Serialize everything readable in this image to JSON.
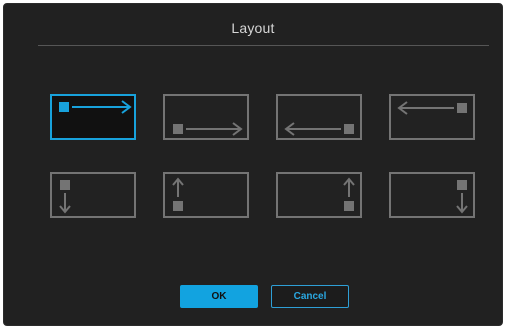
{
  "dialog": {
    "title": "Layout",
    "selected_index": 0,
    "options": [
      {
        "id": "left-to-right-marker-left",
        "icon": "square-arrow-right-icon"
      },
      {
        "id": "left-to-right-marker-bottom",
        "icon": "square-arrow-right-low-icon"
      },
      {
        "id": "right-to-left-marker-right",
        "icon": "arrow-left-square-low-icon"
      },
      {
        "id": "right-to-left-marker-top",
        "icon": "arrow-left-square-icon"
      },
      {
        "id": "top-to-bottom-left",
        "icon": "square-arrow-down-icon"
      },
      {
        "id": "bottom-to-top-left",
        "icon": "arrow-up-square-icon"
      },
      {
        "id": "bottom-to-top-right",
        "icon": "arrow-up-square-right-icon"
      },
      {
        "id": "top-to-bottom-right",
        "icon": "square-arrow-down-right-icon"
      }
    ],
    "ok_label": "OK",
    "cancel_label": "Cancel"
  },
  "colors": {
    "background": "#212121",
    "accent": "#18a2dc",
    "inactive": "#747474"
  }
}
